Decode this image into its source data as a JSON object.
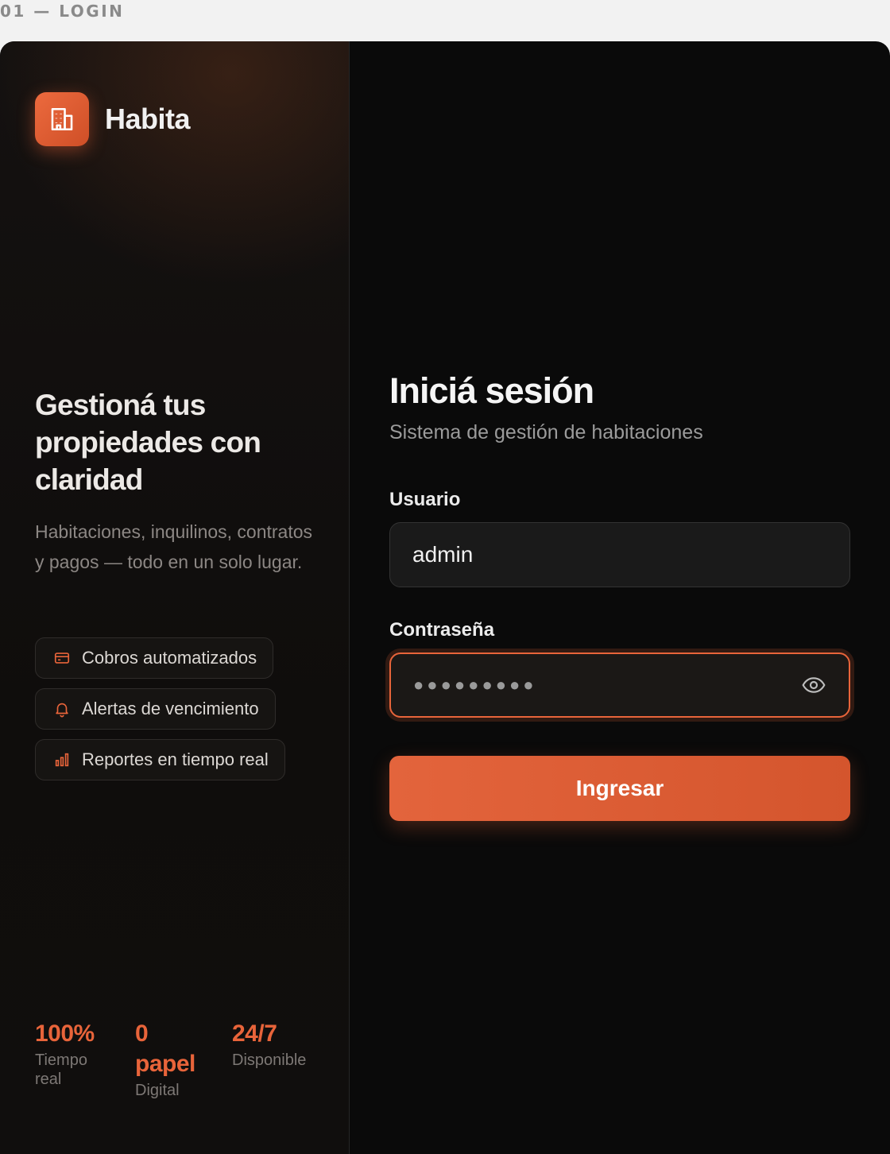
{
  "section_label": "01 — LOGIN",
  "brand": {
    "name": "Habita",
    "logo_icon": "building-icon",
    "accent": "#e8643a"
  },
  "hero": {
    "title": "Gestioná tus propiedades con claridad",
    "text": "Habitaciones, inquilinos, contratos y pagos — todo en un solo lugar.",
    "features": [
      {
        "icon": "credit-card-icon",
        "label": "Cobros automatizados"
      },
      {
        "icon": "bell-icon",
        "label": "Alertas de vencimiento"
      },
      {
        "icon": "bar-chart-icon",
        "label": "Reportes en tiempo real"
      }
    ],
    "stats": [
      {
        "value": "100%",
        "label": "Tiempo real"
      },
      {
        "value": "0 papel",
        "label": "Digital"
      },
      {
        "value": "24/7",
        "label": "Disponible"
      }
    ]
  },
  "login": {
    "title": "Iniciá sesión",
    "subtitle": "Sistema de gestión de habitaciones",
    "username": {
      "label": "Usuario",
      "value": "admin"
    },
    "password": {
      "label": "Contraseña",
      "masked_value": "●●●●●●●●●",
      "toggle_icon": "eye-icon"
    },
    "submit_label": "Ingresar"
  }
}
